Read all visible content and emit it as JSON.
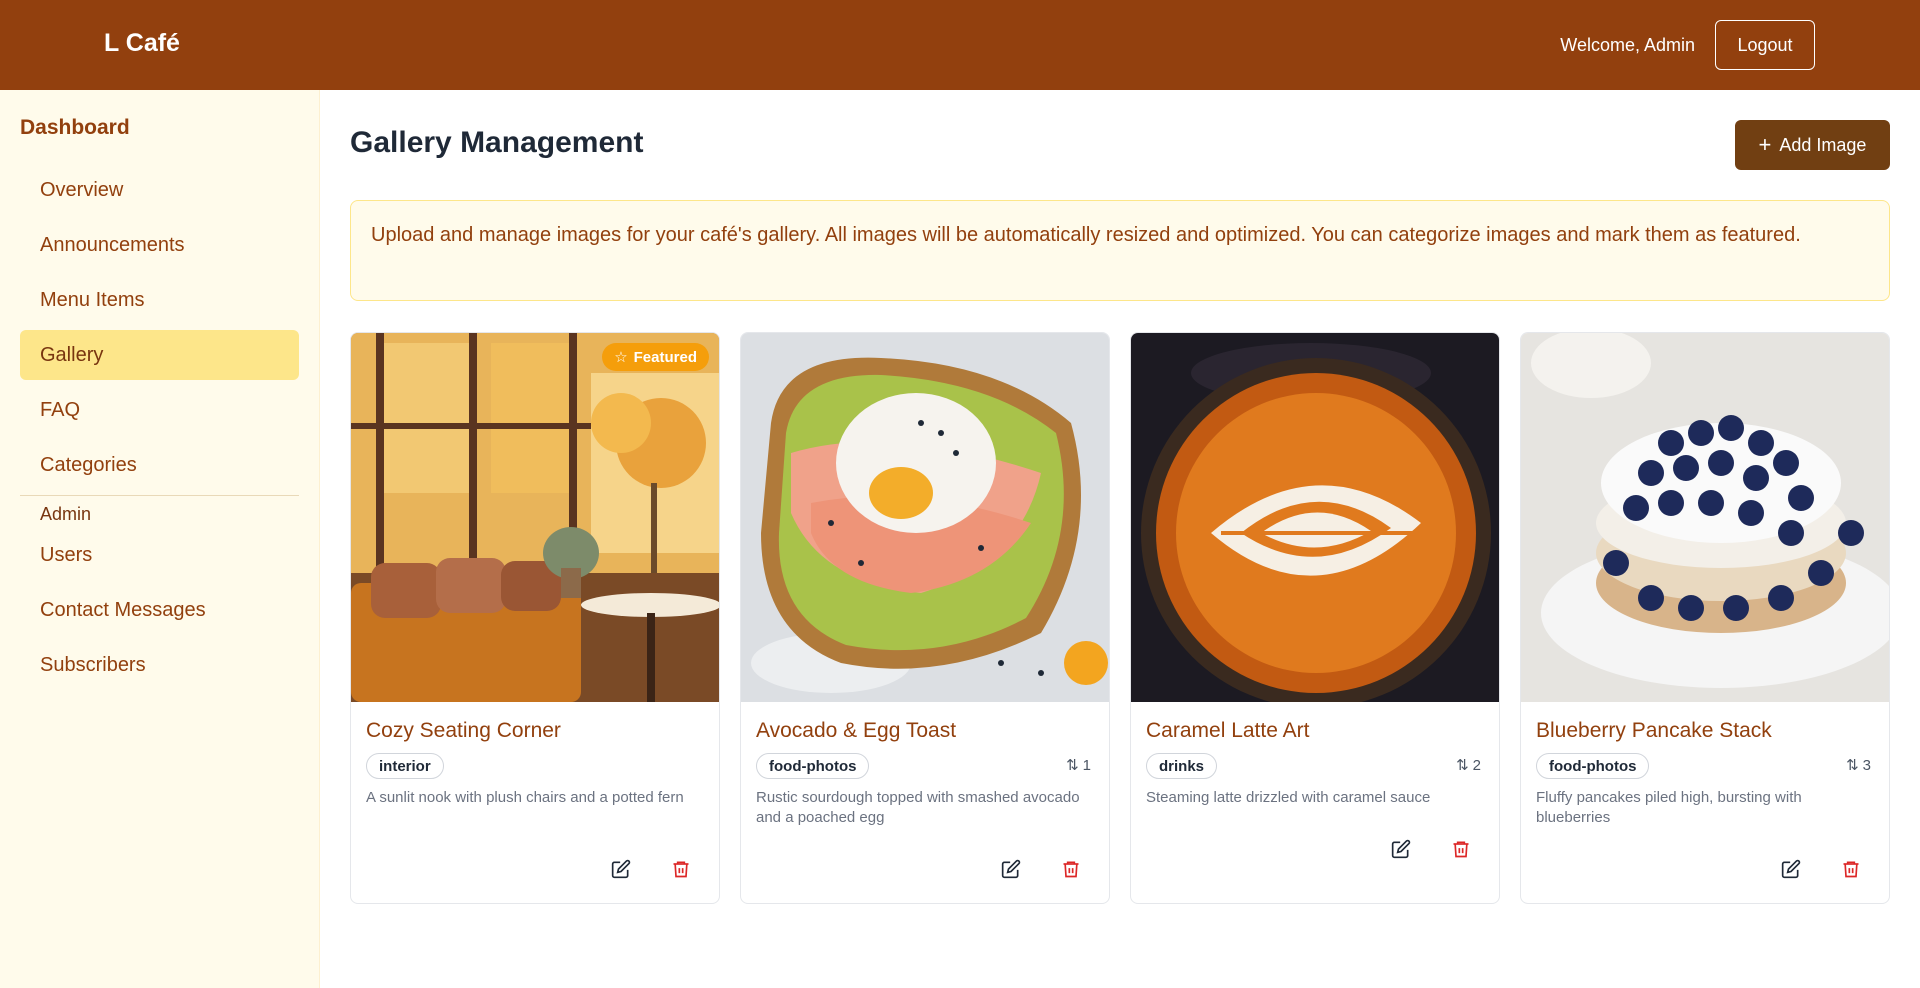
{
  "header": {
    "brand": "L Café",
    "welcome": "Welcome, Admin",
    "logout_label": "Logout"
  },
  "sidebar": {
    "title": "Dashboard",
    "items": [
      {
        "label": "Overview"
      },
      {
        "label": "Announcements"
      },
      {
        "label": "Menu Items"
      },
      {
        "label": "Gallery",
        "active": true
      },
      {
        "label": "FAQ"
      },
      {
        "label": "Categories"
      }
    ],
    "admin_section": "Admin",
    "admin_items": [
      {
        "label": "Users"
      },
      {
        "label": "Contact Messages"
      },
      {
        "label": "Subscribers"
      }
    ]
  },
  "main": {
    "title": "Gallery Management",
    "add_label": "Add Image",
    "info": "Upload and manage images for your café's gallery. All images will be automatically resized and optimized. You can categorize images and mark them as featured."
  },
  "gallery": [
    {
      "title": "Cozy Seating Corner",
      "tag": "interior",
      "order": "",
      "featured_label": "Featured",
      "description": "A sunlit nook with plush chairs and a potted fern"
    },
    {
      "title": "Avocado & Egg Toast",
      "tag": "food-photos",
      "order": "1",
      "description": "Rustic sourdough topped with smashed avocado and a poached egg"
    },
    {
      "title": "Caramel Latte Art",
      "tag": "drinks",
      "order": "2",
      "description": "Steaming latte drizzled with caramel sauce"
    },
    {
      "title": "Blueberry Pancake Stack",
      "tag": "food-photos",
      "order": "3",
      "description": "Fluffy pancakes piled high, bursting with blueberries"
    }
  ],
  "colors": {
    "header_bg": "#92400e",
    "sidebar_bg": "#fffbeb",
    "active_item": "#fde68a",
    "accent_button": "#713f12",
    "featured_badge": "#f59e0b",
    "delete_icon": "#dc2626"
  }
}
